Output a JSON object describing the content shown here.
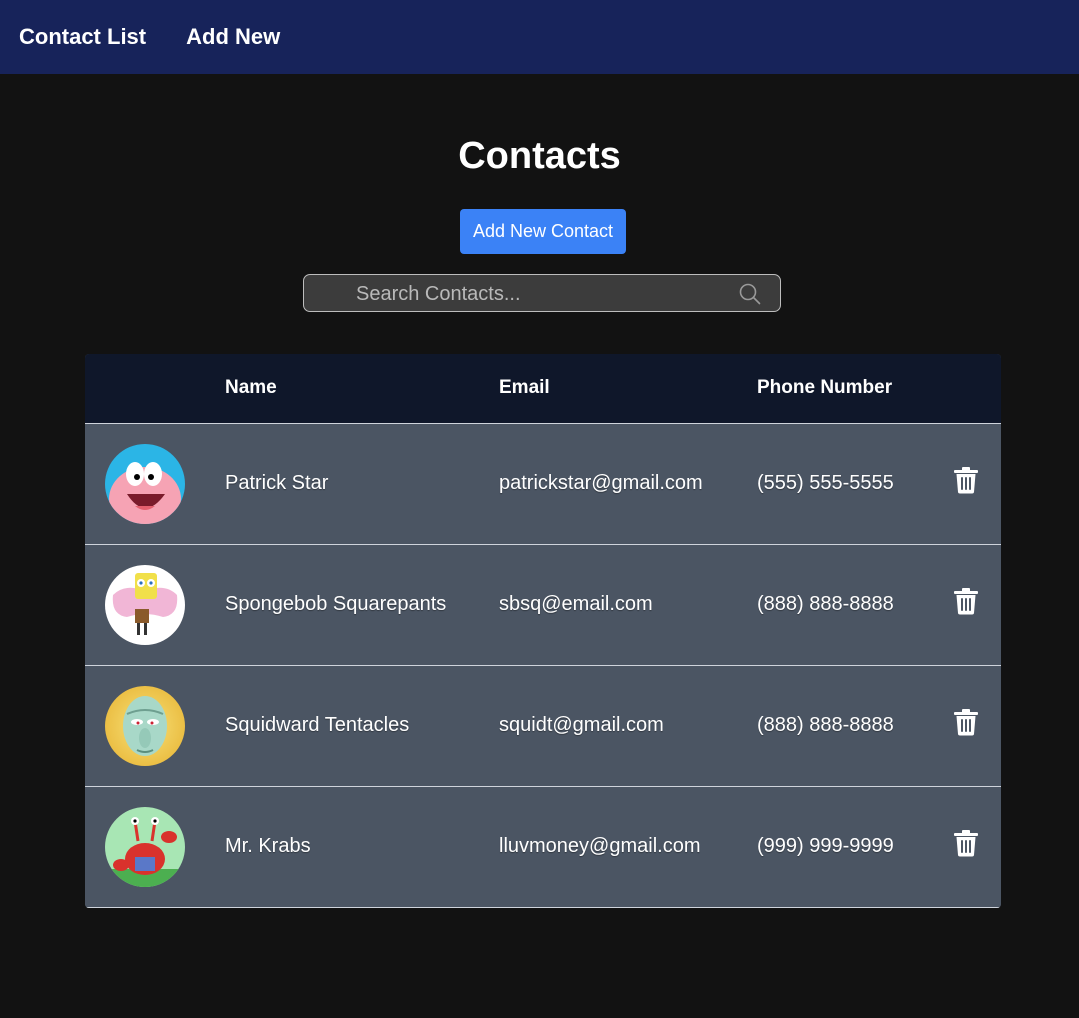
{
  "nav": {
    "items": [
      {
        "label": "Contact List"
      },
      {
        "label": "Add New"
      }
    ]
  },
  "main": {
    "title": "Contacts",
    "add_button_label": "Add New Contact",
    "search": {
      "placeholder": "Search Contacts...",
      "value": "",
      "icon": "search-icon"
    }
  },
  "table": {
    "columns": [
      "",
      "Name",
      "Email",
      "Phone Number",
      ""
    ],
    "rows": [
      {
        "name": "Patrick Star",
        "email": "patrickstar@gmail.com",
        "phone": "(555) 555-5555",
        "avatar_icon": "patrick-avatar"
      },
      {
        "name": "Spongebob Squarepants",
        "email": "sbsq@email.com",
        "phone": "(888) 888-8888",
        "avatar_icon": "spongebob-avatar"
      },
      {
        "name": "Squidward Tentacles",
        "email": "squidt@gmail.com",
        "phone": "(888) 888-8888",
        "avatar_icon": "squidward-avatar"
      },
      {
        "name": "Mr. Krabs",
        "email": "lluvmoney@gmail.com",
        "phone": "(999) 999-9999",
        "avatar_icon": "krabs-avatar"
      }
    ],
    "delete_icon": "trash-icon"
  },
  "colors": {
    "navbar": "#17235a",
    "background": "#121212",
    "accent_button": "#3b82f6",
    "table_header": "#0f172a",
    "table_row": "#4b5563"
  }
}
